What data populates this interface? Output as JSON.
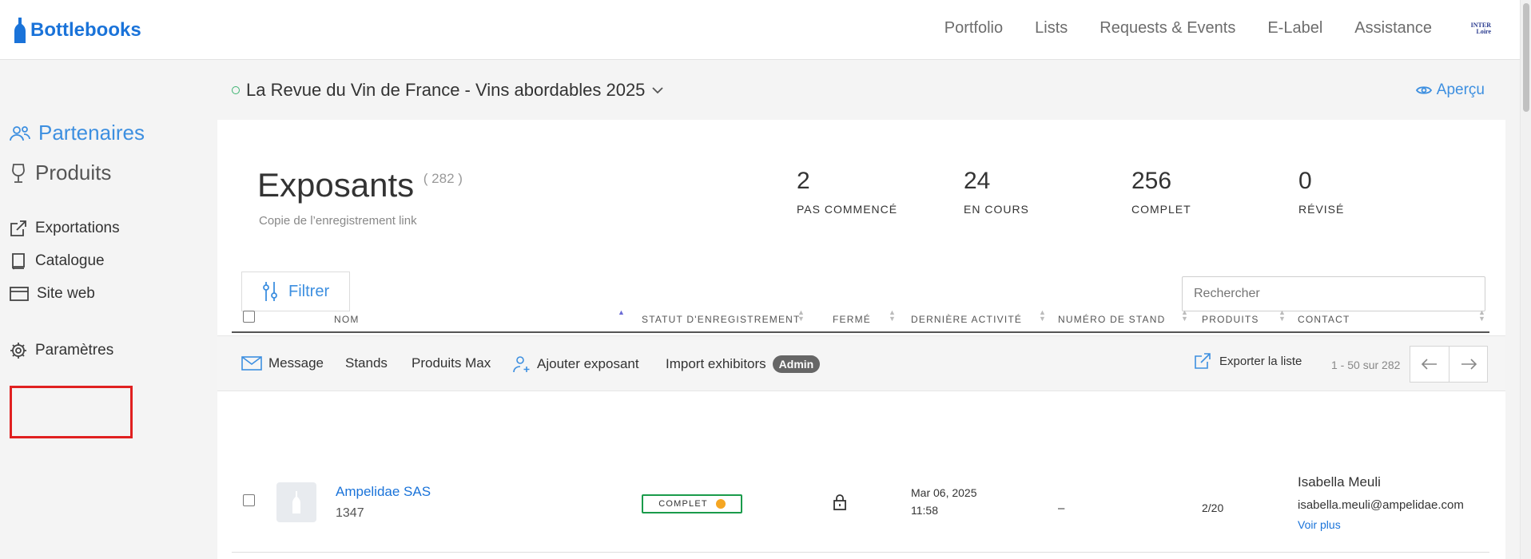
{
  "app": {
    "name": "Bottlebooks"
  },
  "topnav": [
    "Portfolio",
    "Lists",
    "Requests & Events",
    "E-Label",
    "Assistance"
  ],
  "brand_mini": {
    "line1": "INTER",
    "line2": "Loire"
  },
  "sidebar": {
    "primary": [
      {
        "label": "Partenaires",
        "icon": "partners-icon",
        "active": true
      },
      {
        "label": "Produits",
        "icon": "wine-glass-icon",
        "active": false
      }
    ],
    "secondary": [
      {
        "label": "Exportations",
        "icon": "external-link-icon"
      },
      {
        "label": "Catalogue",
        "icon": "book-icon"
      },
      {
        "label": "Site web",
        "icon": "browser-icon"
      }
    ],
    "settings": {
      "label": "Paramètres",
      "icon": "gear-icon"
    }
  },
  "event": {
    "title": "La Revue du Vin de France - Vins abordables 2025",
    "preview_label": "Aperçu"
  },
  "exhibitors": {
    "title": "Exposants",
    "count": "( 282 )",
    "subtitle": "Copie de l’enregistrement link",
    "stats": [
      {
        "value": "2",
        "label": "PAS COMMENCÉ"
      },
      {
        "value": "24",
        "label": "EN COURS"
      },
      {
        "value": "256",
        "label": "COMPLET"
      },
      {
        "value": "0",
        "label": "RÉVISÉ"
      }
    ]
  },
  "filter": {
    "label": "Filtrer"
  },
  "search": {
    "placeholder": "Rechercher"
  },
  "toolbar": {
    "message": "Message",
    "stands": "Stands",
    "produits_max": "Produits Max",
    "add_exhibitor": "Ajouter exposant",
    "import": "Import exhibitors",
    "admin_badge": "Admin",
    "export": "Exporter la liste",
    "pager_text": "1 - 50 sur 282"
  },
  "table": {
    "headers": [
      "Nom",
      "Statut d'enregistrement",
      "Fermé",
      "Dernière activité",
      "Numéro de stand",
      "Produits",
      "Contact"
    ],
    "rows": [
      {
        "name": "Ampelidae SAS",
        "id": "1347",
        "status": "COMPLET",
        "date": "Mar 06, 2025",
        "time": "11:58",
        "stand": "–",
        "products": "2/20",
        "contact_name": "Isabella Meuli",
        "contact_email": "isabella.meuli@ampelidae.com",
        "more": "Voir plus"
      }
    ]
  },
  "colors": {
    "accent": "#3d8fe0",
    "brand": "#1a73d9",
    "highlight": "#e02020",
    "status_ok": "#1a9b4b",
    "status_dot": "#f5a623"
  }
}
